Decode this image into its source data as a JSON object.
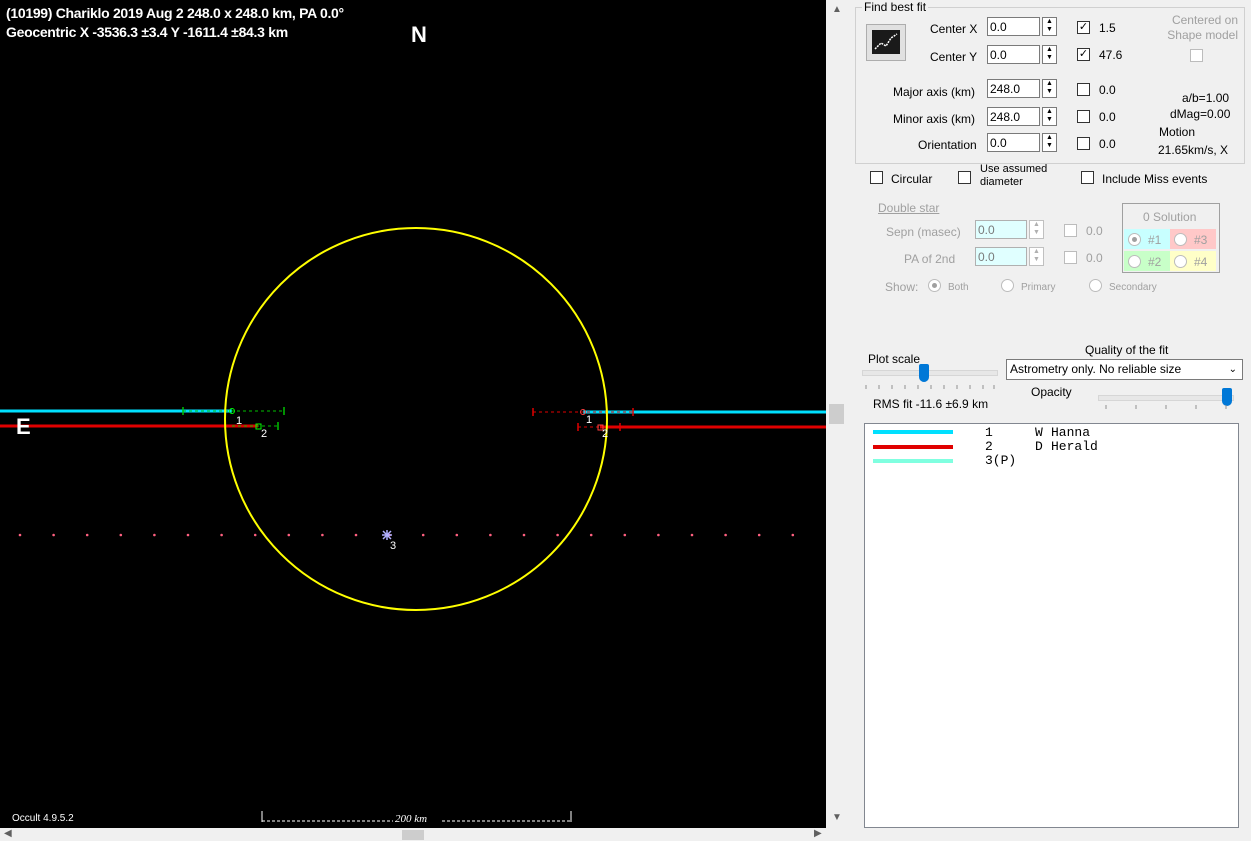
{
  "plot": {
    "title_line1": "(10199) Chariklo 2019 Aug 2  248.0 x 248.0 km, PA 0.0°",
    "title_line2": "Geocentric  X  -3536.3 ±3.4  Y -1611.4 ±84.3 km",
    "north_label": "N",
    "east_label": "E",
    "version": "Occult 4.9.5.2",
    "scale_label": "200 km",
    "ellipse_color": "#ffff00",
    "chord_labels": [
      "1",
      "2",
      "1",
      "2",
      "3"
    ]
  },
  "panel": {
    "find_best_fit_label": "Find best fit",
    "center_x_label": "Center X",
    "center_x_value": "0.0",
    "center_x_fit_checked": true,
    "center_x_fit_value": "1.5",
    "center_y_label": "Center Y",
    "center_y_value": "0.0",
    "center_y_fit_checked": true,
    "center_y_fit_value": "47.6",
    "centered_on_shape_label": "Centered on Shape model",
    "major_axis_label": "Major axis (km)",
    "major_axis_value": "248.0",
    "major_fit_value": "0.0",
    "minor_axis_label": "Minor axis (km)",
    "minor_axis_value": "248.0",
    "minor_fit_value": "0.0",
    "orientation_label": "Orientation",
    "orientation_value": "0.0",
    "orientation_fit_value": "0.0",
    "ab_ratio": "a/b=1.00",
    "dmag": "dMag=0.00",
    "motion_label": "Motion",
    "motion_value": "21.65km/s, X",
    "circular_label": "Circular",
    "use_assumed_label": "Use assumed diameter",
    "include_miss_label": "Include Miss events",
    "double_star_label": "Double star",
    "sepn_label": "Sepn (masec)",
    "sepn_value": "0.0",
    "sepn_fit_value": "0.0",
    "pa2_label": "PA of 2nd",
    "pa2_value": "0.0",
    "pa2_fit_value": "0.0",
    "show_label": "Show:",
    "show_both": "Both",
    "show_primary": "Primary",
    "show_secondary": "Secondary",
    "solution_title": "0 Solution",
    "solutions": [
      "#1",
      "#3",
      "#2",
      "#4"
    ],
    "solution_colors": [
      "#c8ffff",
      "#ffc8c8",
      "#c8ffc8",
      "#ffffc8"
    ],
    "plot_scale_label": "Plot scale",
    "quality_label": "Quality of the fit",
    "quality_value": "Astrometry only. No reliable size",
    "opacity_label": "Opacity",
    "rms_fit": "RMS fit -11.6 ±6.9 km"
  },
  "observers": [
    {
      "num": "1",
      "code": "W",
      "name": "Hanna",
      "color": "#00e0ff"
    },
    {
      "num": "2",
      "code": "D",
      "name": "Herald",
      "color": "#e00000"
    },
    {
      "num": "3(P)",
      "code": "",
      "name": "",
      "color": "#80ffe0"
    }
  ]
}
